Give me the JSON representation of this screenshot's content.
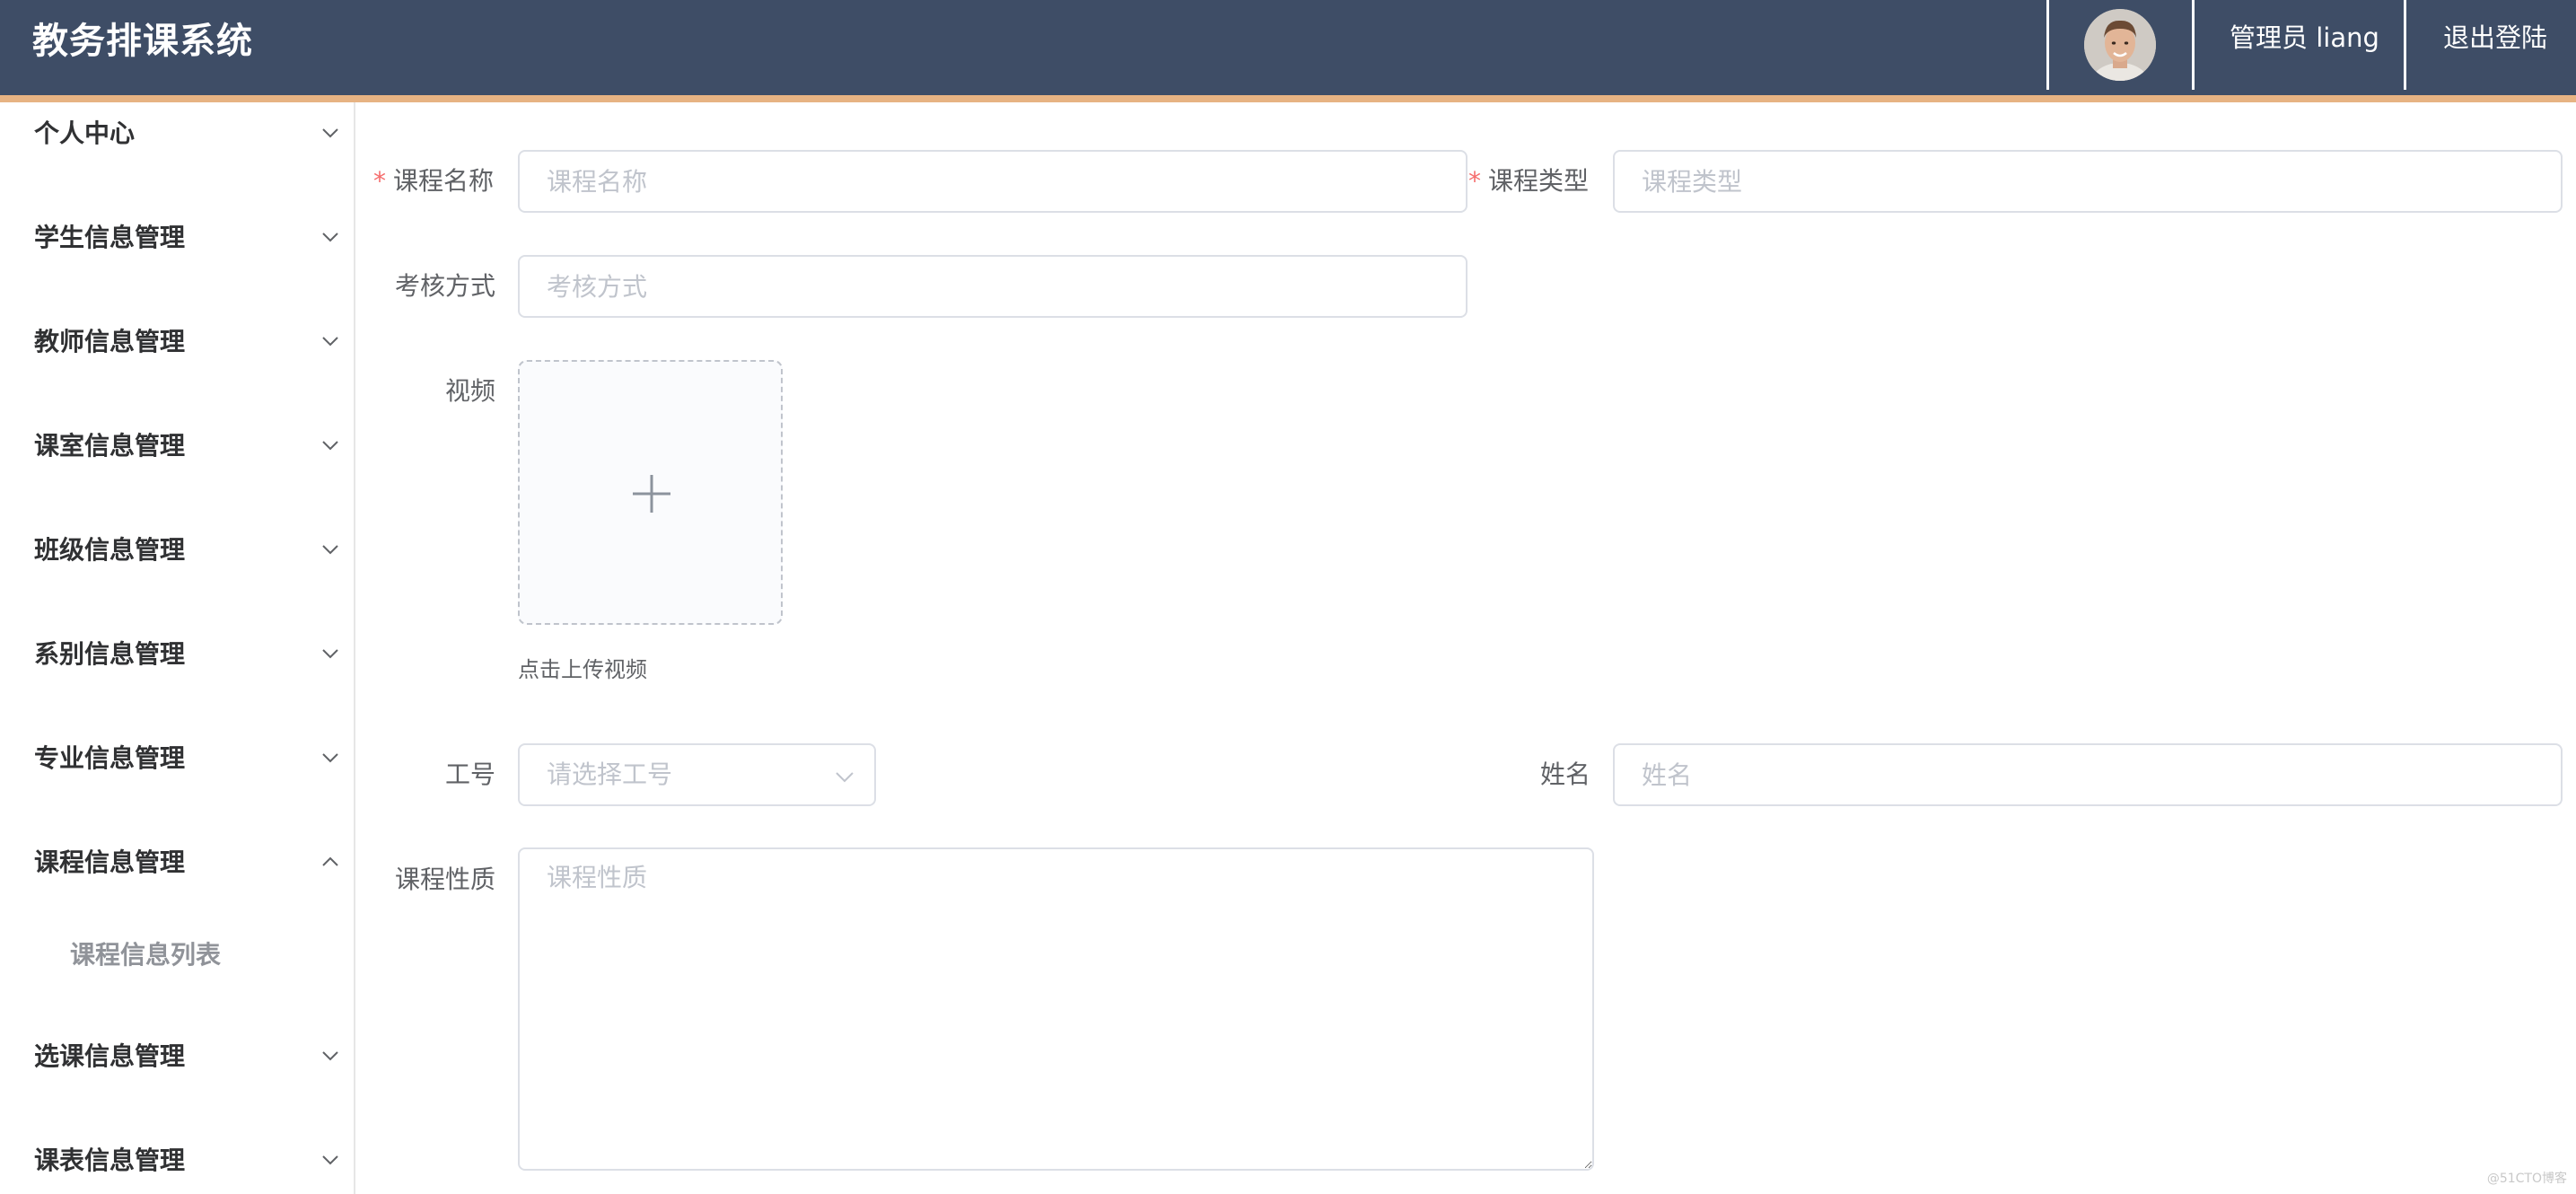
{
  "header": {
    "title": "教务排课系统",
    "user_label": "管理员 liang",
    "logout_label": "退出登陆",
    "colors": {
      "background": "#3e4d66",
      "accent_strip": "#e7b383"
    }
  },
  "sidebar": {
    "items": [
      {
        "label": "个人中心",
        "expanded": false,
        "icon": "chevron-down-icon"
      },
      {
        "label": "学生信息管理",
        "expanded": false,
        "icon": "chevron-down-icon"
      },
      {
        "label": "教师信息管理",
        "expanded": false,
        "icon": "chevron-down-icon"
      },
      {
        "label": "课室信息管理",
        "expanded": false,
        "icon": "chevron-down-icon"
      },
      {
        "label": "班级信息管理",
        "expanded": false,
        "icon": "chevron-down-icon"
      },
      {
        "label": "系别信息管理",
        "expanded": false,
        "icon": "chevron-down-icon"
      },
      {
        "label": "专业信息管理",
        "expanded": false,
        "icon": "chevron-down-icon"
      },
      {
        "label": "课程信息管理",
        "expanded": true,
        "icon": "chevron-up-icon"
      },
      {
        "label": "选课信息管理",
        "expanded": false,
        "icon": "chevron-down-icon"
      },
      {
        "label": "课表信息管理",
        "expanded": false,
        "icon": "chevron-down-icon"
      }
    ],
    "sub_items": [
      {
        "label": "课程信息列表"
      }
    ]
  },
  "form": {
    "course_name": {
      "label": "课程名称",
      "required": true,
      "placeholder": "课程名称",
      "value": ""
    },
    "course_type": {
      "label": "课程类型",
      "required": true,
      "placeholder": "课程类型",
      "value": ""
    },
    "exam_method": {
      "label": "考核方式",
      "placeholder": "考核方式",
      "value": ""
    },
    "video": {
      "label": "视频",
      "hint": "点击上传视频",
      "icon": "plus-icon"
    },
    "staff_id": {
      "label": "工号",
      "placeholder": "请选择工号",
      "icon": "chevron-down-icon"
    },
    "name": {
      "label": "姓名",
      "placeholder": "姓名",
      "value": ""
    },
    "course_nature": {
      "label": "课程性质",
      "placeholder": "课程性质",
      "value": ""
    }
  },
  "watermark": "@51CTO博客"
}
